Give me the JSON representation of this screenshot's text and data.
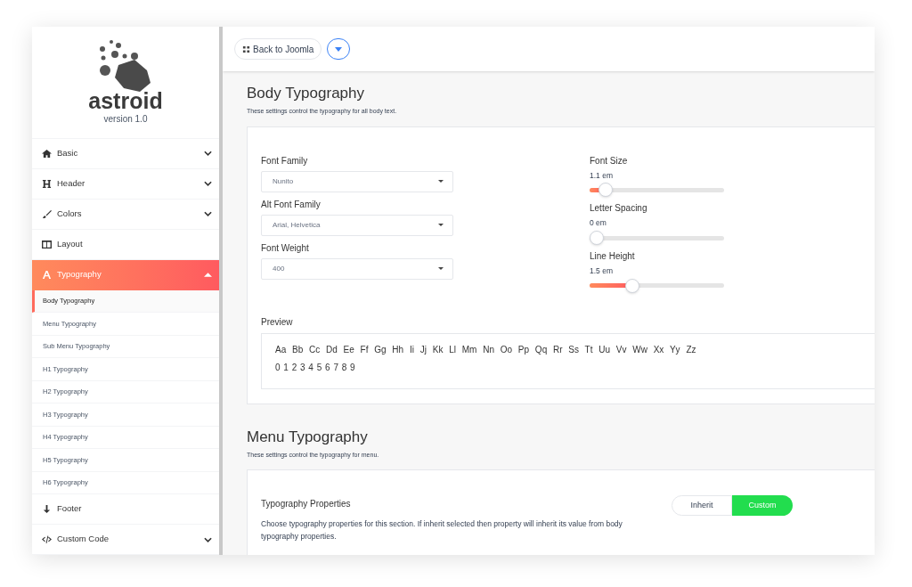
{
  "logo": {
    "name": "astroid",
    "version": "version 1.0"
  },
  "sidebar": {
    "items": [
      {
        "label": "Basic",
        "expanded": false,
        "selected": false
      },
      {
        "label": "Header",
        "expanded": false,
        "selected": false
      },
      {
        "label": "Colors",
        "expanded": false,
        "selected": false
      },
      {
        "label": "Layout",
        "selected": false
      },
      {
        "label": "Typography",
        "expanded": true,
        "selected": true,
        "children": [
          {
            "label": "Body Typography",
            "selected": true
          },
          {
            "label": "Menu Typography",
            "selected": false
          },
          {
            "label": "Sub Menu Typography",
            "selected": false
          },
          {
            "label": "H1 Typography",
            "selected": false
          },
          {
            "label": "H2 Typography",
            "selected": false
          },
          {
            "label": "H3 Typography",
            "selected": false
          },
          {
            "label": "H4 Typography",
            "selected": false
          },
          {
            "label": "H5 Typography",
            "selected": false
          },
          {
            "label": "H6 Typography",
            "selected": false
          }
        ]
      },
      {
        "label": "Footer",
        "selected": false
      },
      {
        "label": "Custom Code",
        "expanded": false,
        "selected": false
      }
    ]
  },
  "toolbar": {
    "back_button": "Back to Joomla"
  },
  "body_typography": {
    "title": "Body Typography",
    "description": "These settings control the typography for all body text.",
    "selects": [
      {
        "label": "Font Family",
        "value": "Nunito"
      },
      {
        "label": "Alt Font Family",
        "value": "Arial, Helvetica"
      },
      {
        "label": "Font Weight",
        "value": "400"
      }
    ],
    "sliders": [
      {
        "label": "Font Size",
        "reading": "1.1 em",
        "level": 0.12
      },
      {
        "label": "Letter Spacing",
        "reading": "0 em",
        "level": 0
      },
      {
        "label": "Line Height",
        "reading": "1.5 em",
        "level": 0.32
      }
    ],
    "preview": {
      "label": "Preview",
      "letters": "Aa Bb Cc Dd Ee Ff Gg Hh Ii Jj Kk Ll Mm Nn Oo Pp Qq Rr Ss Tt Uu Vv Ww Xx Yy Zz",
      "digits": "0 1 2 3 4 5 6 7 8 9"
    }
  },
  "menu_typography": {
    "title": "Menu Typography",
    "description": "These settings control the typography for menu.",
    "property_title": "Typography Properties",
    "property_description": "Choose typography properties for this section. If inherit selected then property will inherit its value from body typography properties.",
    "options": [
      {
        "label": "Inherit",
        "selected": false
      },
      {
        "label": "Custom",
        "selected": true
      }
    ]
  }
}
